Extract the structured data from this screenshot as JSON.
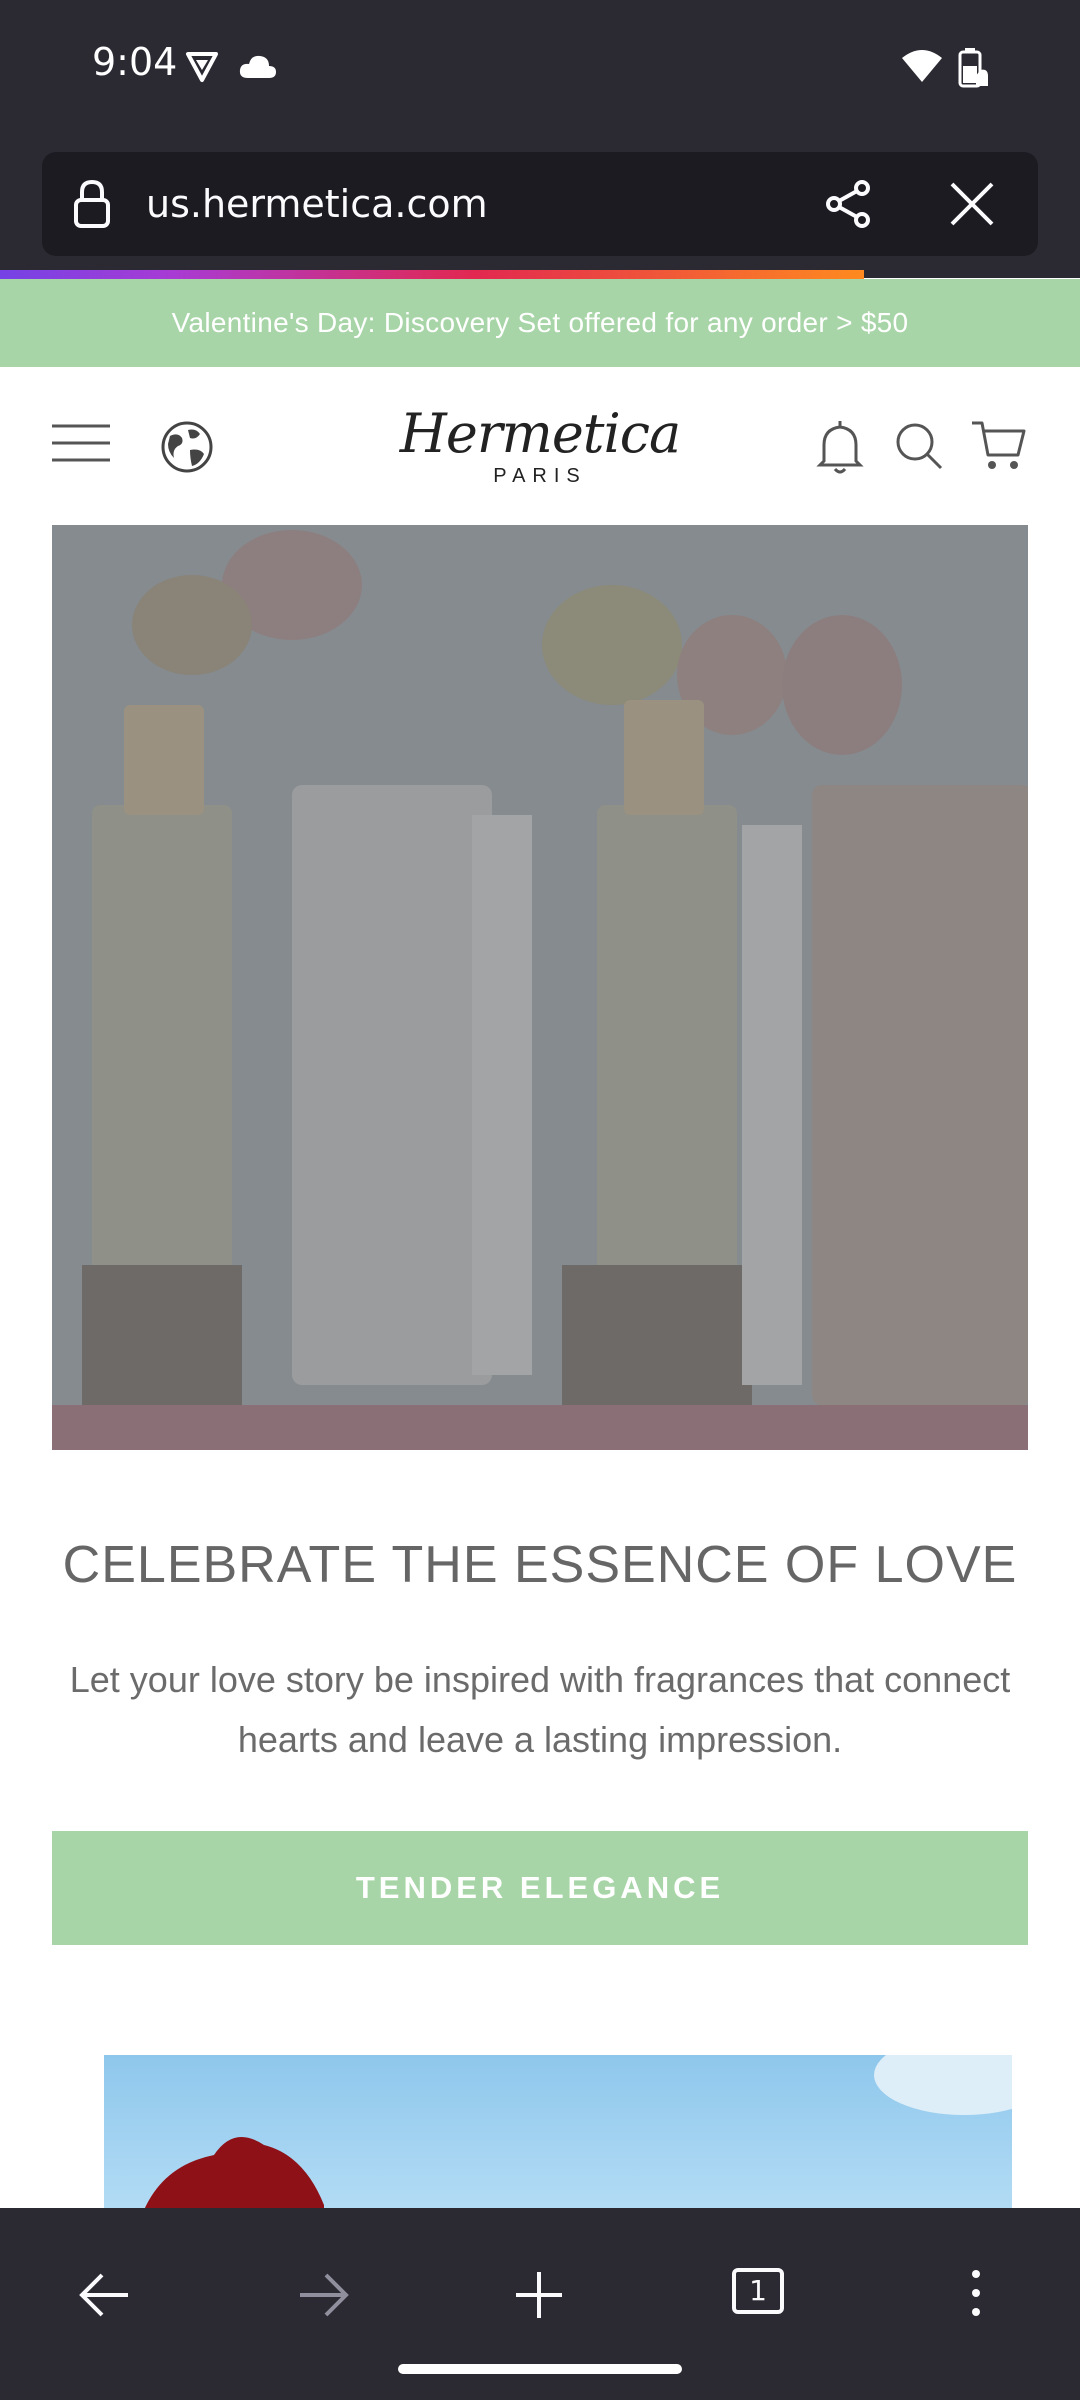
{
  "status_bar": {
    "time": "9:04"
  },
  "browser": {
    "url": "us.hermetica.com",
    "progress_fraction": 0.8,
    "tab_count": "1"
  },
  "promo_banner": {
    "text": "Valentine's Day: Discovery Set offered for any order > $50"
  },
  "site_header": {
    "logo_text": "Hermetica",
    "logo_subtext": "PARIS"
  },
  "hero": {
    "heading": "CELEBRATE THE ESSENCE OF LOVE",
    "paragraph": "Let your love story be inspired with fragrances that connect hearts and leave a lasting impression.",
    "cta_label": "TENDER ELEGANCE"
  },
  "colors": {
    "accent_green": "#a8d5a8",
    "browser_chrome": "#2b2a33",
    "url_field": "#1c1b22",
    "hero_overlay": "#878c8f"
  },
  "icons": [
    "lock-icon",
    "share-icon",
    "close-icon",
    "menu-icon",
    "globe-icon",
    "bell-icon",
    "search-icon",
    "cart-icon",
    "back-icon",
    "forward-icon",
    "new-tab-icon",
    "tabs-icon",
    "more-menu-icon",
    "wifi-icon",
    "battery-icon"
  ]
}
